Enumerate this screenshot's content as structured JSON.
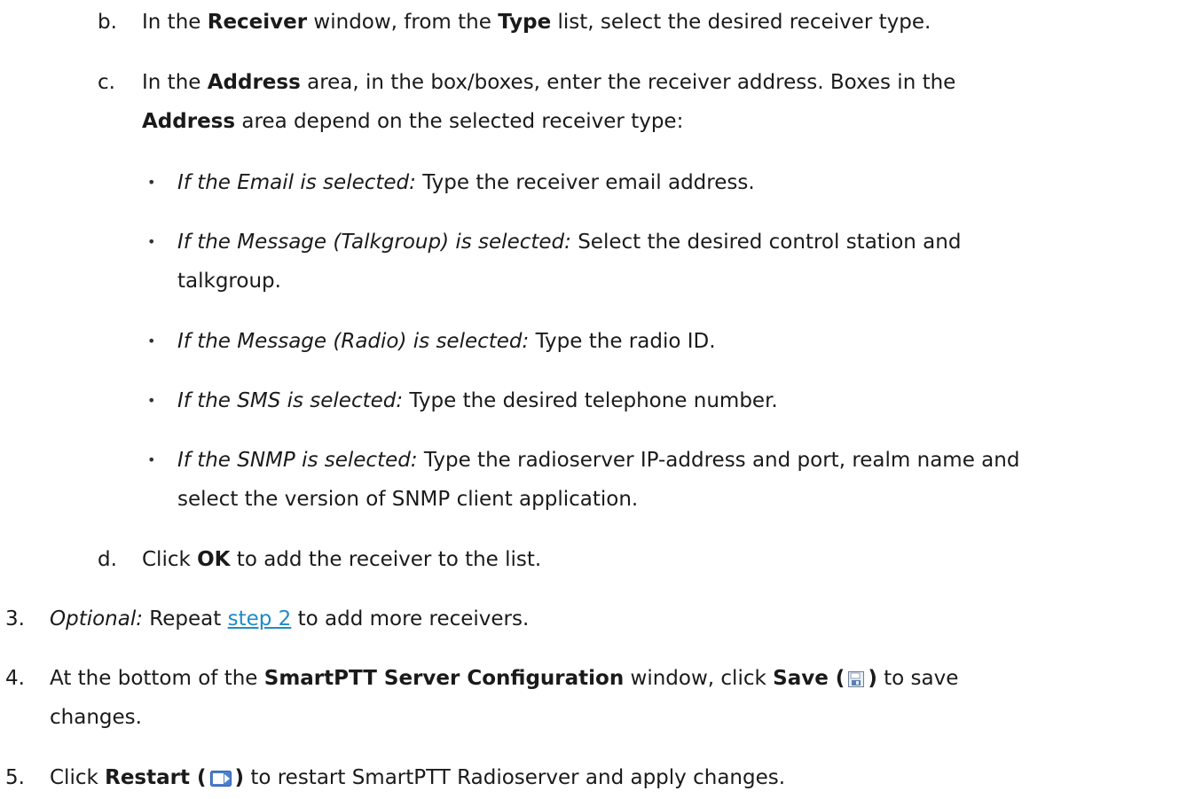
{
  "steps": {
    "b": {
      "marker": "b.",
      "t1": "In the ",
      "receiver": "Receiver",
      "t2": " window, from the ",
      "type": "Type",
      "t3": " list, select the desired receiver type."
    },
    "c": {
      "marker": "c.",
      "t1": "In the ",
      "address": "Address",
      "t2": " area, in the box/boxes, enter the receiver address. Boxes in the",
      "address2": "Address",
      "t3": " area depend on the selected receiver type:"
    },
    "bullets": [
      {
        "italic": "If the Email is selected:",
        "text": " Type the receiver email address."
      },
      {
        "italic": "If the Message (Talkgroup) is selected:",
        "text": " Select the desired control station and",
        "cont": "talkgroup."
      },
      {
        "italic": "If the Message (Radio) is selected:",
        "text": " Type the radio ID."
      },
      {
        "italic": "If the SMS is selected:",
        "text": " Type the desired telephone number."
      },
      {
        "italic": "If the SNMP is selected:",
        "text": " Type the radioserver IP-address and port, realm name and",
        "cont": "select the version of SNMP client application."
      }
    ],
    "bullet_char": "•",
    "d": {
      "marker": "d.",
      "t1": "Click ",
      "ok": "OK",
      "t2": " to add the receiver to the list."
    },
    "s3": {
      "marker": "3.",
      "optional": "Optional:",
      "t1": " Repeat ",
      "link": "step 2",
      "t2": " to add more receivers."
    },
    "s4": {
      "marker": "4.",
      "t1": "At the bottom of the ",
      "window": "SmartPTT Server Configuration",
      "t2": " window, click ",
      "save": "Save (",
      "close": ")",
      "t3": " to save",
      "cont": "changes."
    },
    "s5": {
      "marker": "5.",
      "t1": "Click ",
      "restart": "Restart (",
      "close": ")",
      "t2": " to restart SmartPTT Radioserver and apply changes."
    }
  },
  "icons": {
    "save": "save-icon",
    "restart": "restart-icon"
  },
  "colors": {
    "link": "#1f8bc6",
    "text": "#1a1a1a"
  }
}
